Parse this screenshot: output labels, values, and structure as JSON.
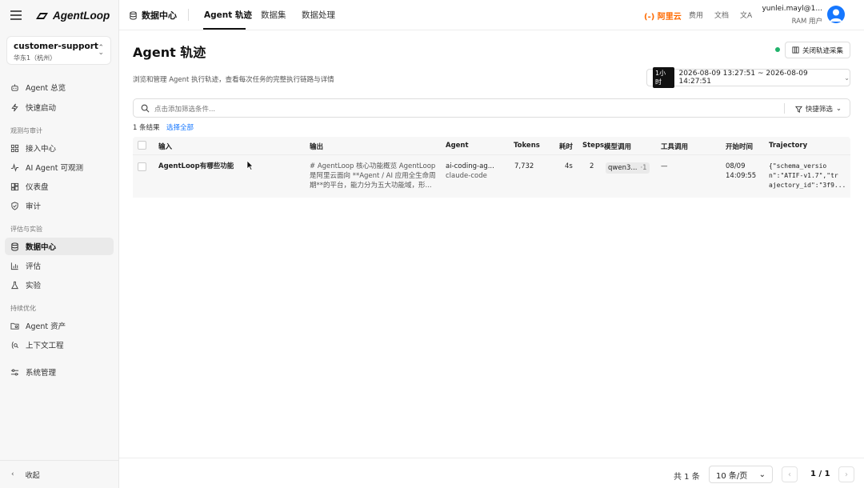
{
  "app": {
    "logo_text": "AgentLoop"
  },
  "workspace": {
    "name": "customer-support",
    "region": "华东1（杭州）"
  },
  "sidebar": {
    "items": [
      {
        "label": "Agent 总览",
        "icon": "robot-icon"
      },
      {
        "label": "快速启动",
        "icon": "bolt-icon"
      }
    ],
    "section_observe": "观测与审计",
    "observe_items": [
      {
        "label": "接入中心",
        "icon": "grid-icon"
      },
      {
        "label": "AI Agent 可观测",
        "icon": "activity-icon"
      },
      {
        "label": "仪表盘",
        "icon": "dashboard-icon"
      },
      {
        "label": "审计",
        "icon": "shield-icon"
      }
    ],
    "section_eval": "评估与实验",
    "eval_items": [
      {
        "label": "数据中心",
        "icon": "database-icon",
        "active": true
      },
      {
        "label": "评估",
        "icon": "bar-chart-icon"
      },
      {
        "label": "实验",
        "icon": "flask-icon"
      }
    ],
    "section_opt": "持续优化",
    "opt_items": [
      {
        "label": "Agent 资产",
        "icon": "folder-icon"
      },
      {
        "label": "上下文工程",
        "icon": "context-icon"
      }
    ],
    "system": {
      "label": "系统管理",
      "icon": "sliders-icon"
    },
    "collapse_label": "收起"
  },
  "header": {
    "title": "数据中心",
    "tabs": [
      "Agent 轨迹",
      "数据集",
      "数据处理"
    ],
    "brand": "阿里云",
    "links": [
      "费用",
      "文档"
    ],
    "user_name": "yunlei.mayl@1...",
    "user_role": "RAM 用户"
  },
  "page": {
    "title": "Agent 轨迹",
    "description": "浏览和管理 Agent 执行轨迹，查看每次任务的完整执行链路与详情",
    "close_button": "关闭轨迹采集",
    "status_color": "#20b26b",
    "time_badge": "1小时",
    "time_range": "2026-08-09 13:27:51 ~ 2026-08-09 14:27:51",
    "filter_placeholder": "点击添加筛选条件...",
    "quick_filter": "快捷筛选",
    "result_count": "1 条结果",
    "select_all": "选择全部"
  },
  "table": {
    "columns": [
      "输入",
      "输出",
      "Agent",
      "Tokens",
      "耗时",
      "Steps",
      "模型调用",
      "工具调用",
      "开始时间",
      "Trajectory"
    ],
    "rows": [
      {
        "input": "AgentLoop有哪些功能",
        "output_1": "# AgentLoop 核心功能概览 AgentLoop",
        "output_2": "是阿里云面向 **Agent / AI 应用全生命周",
        "output_3": "期**的平台，能力分为五大功能域，形...",
        "agent": "ai-coding-ag...",
        "agent_sub": "claude-code",
        "tokens": "7,732",
        "duration": "4s",
        "steps": "2",
        "model": "qwen3...",
        "model_more": "·1",
        "tools": "—",
        "start_date": "08/09",
        "start_time": "14:09:55",
        "traj_1": "{\"schema_versio",
        "traj_2": "n\":\"ATIF-v1.7\",\"tr",
        "traj_3": "ajectory_id\":\"3f9..."
      }
    ]
  },
  "footer": {
    "total": "共 1 条",
    "page_size": "10 条/页",
    "page": "1 / 1"
  }
}
